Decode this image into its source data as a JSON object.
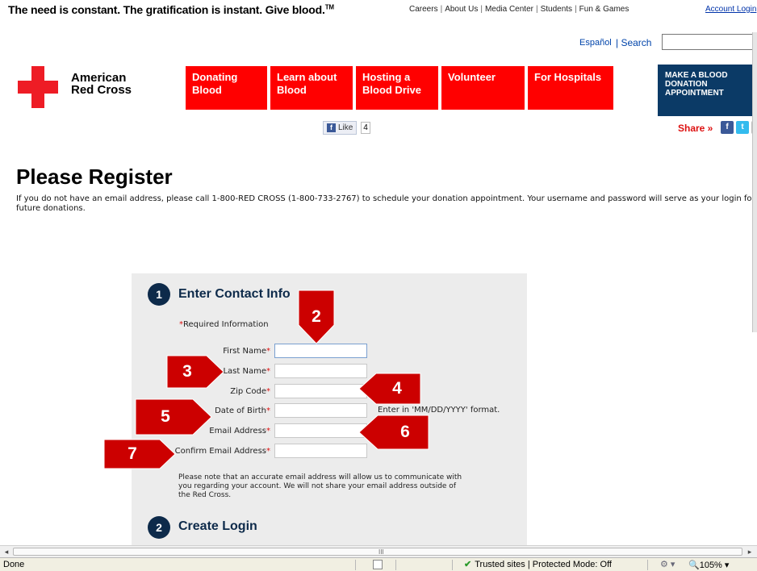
{
  "header": {
    "tagline": "The need is constant. The gratification is instant. Give blood.",
    "tagline_tm": "TM",
    "top_links": [
      "Careers",
      "About Us",
      "Media Center",
      "Students",
      "Fun & Games"
    ],
    "account_login": "Account Login",
    "espanol": "Español",
    "search_label": "| Search",
    "search_value": ""
  },
  "logo": {
    "line1": "American",
    "line2": "Red Cross"
  },
  "nav": {
    "items": [
      {
        "line1": "Donating",
        "line2": "Blood"
      },
      {
        "line1": "Learn about",
        "line2": "Blood"
      },
      {
        "line1": "Hosting a",
        "line2": "Blood Drive"
      },
      {
        "line1": "Volunteer",
        "line2": ""
      },
      {
        "line1": "For Hospitals",
        "line2": ""
      }
    ],
    "appointment": {
      "line1": "MAKE A BLOOD",
      "line2": "DONATION",
      "line3": "APPOINTMENT"
    }
  },
  "social": {
    "like_label": "Like",
    "like_count": "4",
    "share_label": "Share »"
  },
  "main": {
    "title": "Please Register",
    "intro": "If you do not have an email address, please call 1-800-RED CROSS (1-800-733-2767) to schedule your donation appointment. Your username and password will serve as your login for future donations."
  },
  "form": {
    "step1_num": "1",
    "step1_title": "Enter Contact Info",
    "required_star": "*",
    "required_text": "Required Information",
    "fields": [
      {
        "label": "First Name",
        "value": ""
      },
      {
        "label": "Last Name",
        "value": ""
      },
      {
        "label": "Zip Code",
        "value": ""
      },
      {
        "label": "Date of Birth",
        "value": ""
      },
      {
        "label": "Email Address",
        "value": ""
      },
      {
        "label": "Confirm Email Address",
        "value": ""
      }
    ],
    "dob_hint": "Enter in 'MM/DD/YYYY' format.",
    "note": "Please note that an accurate email address will allow us to communicate with you regarding your account. We will not share your email address outside of the Red Cross.",
    "step2_num": "2",
    "step2_title": "Create Login"
  },
  "callouts": [
    "2",
    "3",
    "4",
    "5",
    "6",
    "7"
  ],
  "callout_color": "#cc0000",
  "statusbar": {
    "left": "Done",
    "zone": "Trusted sites | Protected Mode: Off",
    "zoom": "105%",
    "scroll_grip": "III"
  }
}
